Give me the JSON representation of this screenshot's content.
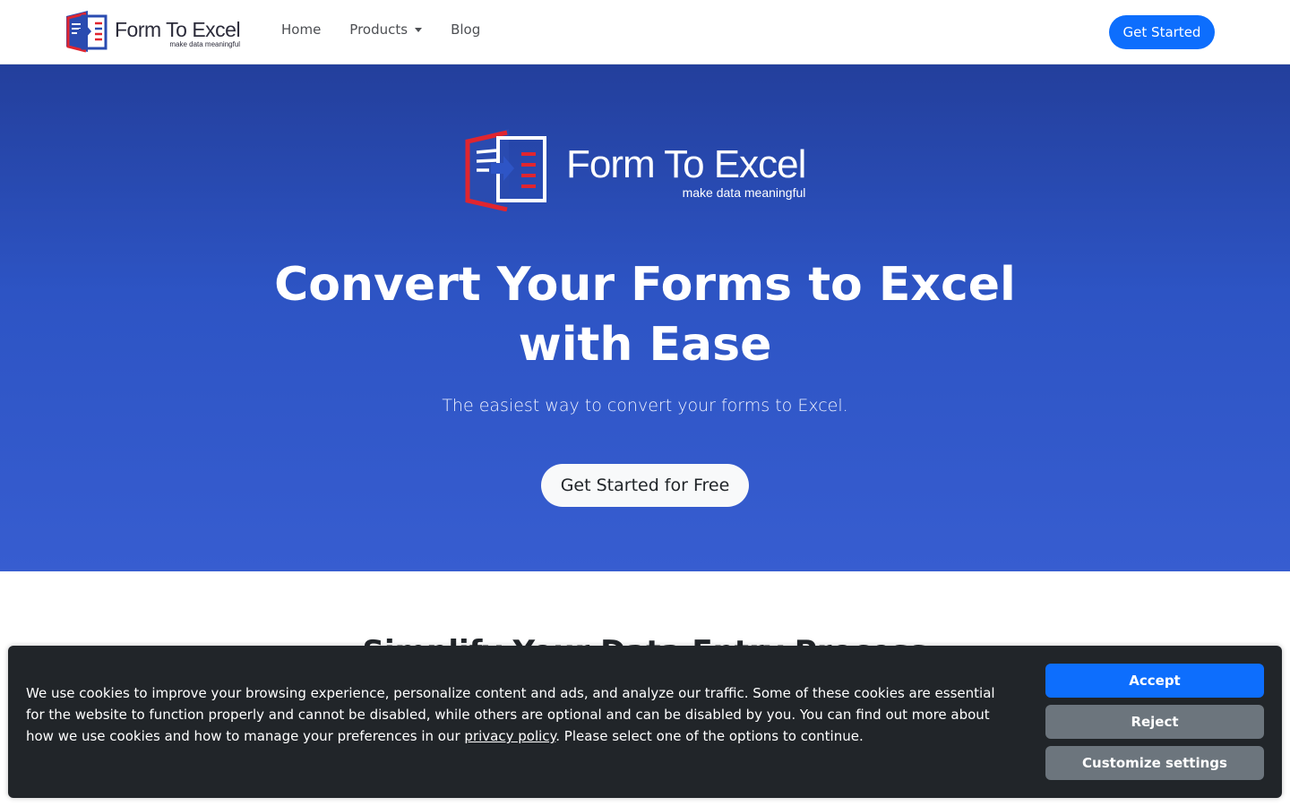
{
  "navbar": {
    "brand_name": "Form To Excel",
    "brand_tagline": "make data meaningful",
    "links": [
      {
        "label": "Home"
      },
      {
        "label": "Products"
      },
      {
        "label": "Blog"
      }
    ],
    "cta_label": "Get Started"
  },
  "hero": {
    "logo_name": "Form To Excel",
    "logo_tagline": "make data meaningful",
    "title_line1": "Convert Your Forms to Excel",
    "title_line2": "with Ease",
    "subtitle": "The easiest way to convert your forms to Excel.",
    "cta_label": "Get Started for Free"
  },
  "next_section": {
    "heading": "Simplify Your Data Entry Process"
  },
  "cookie_banner": {
    "text_before_link": "We use cookies to improve your browsing experience, personalize content and ads, and analyze our traffic. Some of these cookies are essential for the website to function properly and cannot be disabled, while others are optional and can be disabled by you. You can find out more about how we use cookies and how to manage your preferences in our ",
    "link_label": "privacy policy",
    "text_after_link": ". Please select one of the options to continue.",
    "accept_label": "Accept",
    "reject_label": "Reject",
    "customize_label": "Customize settings"
  },
  "colors": {
    "primary": "#0d6efd",
    "hero_top": "#233f9c",
    "hero_bottom": "#375dd0",
    "logo_red": "#e0252f",
    "banner_bg": "#212529",
    "secondary": "#6c757d"
  }
}
